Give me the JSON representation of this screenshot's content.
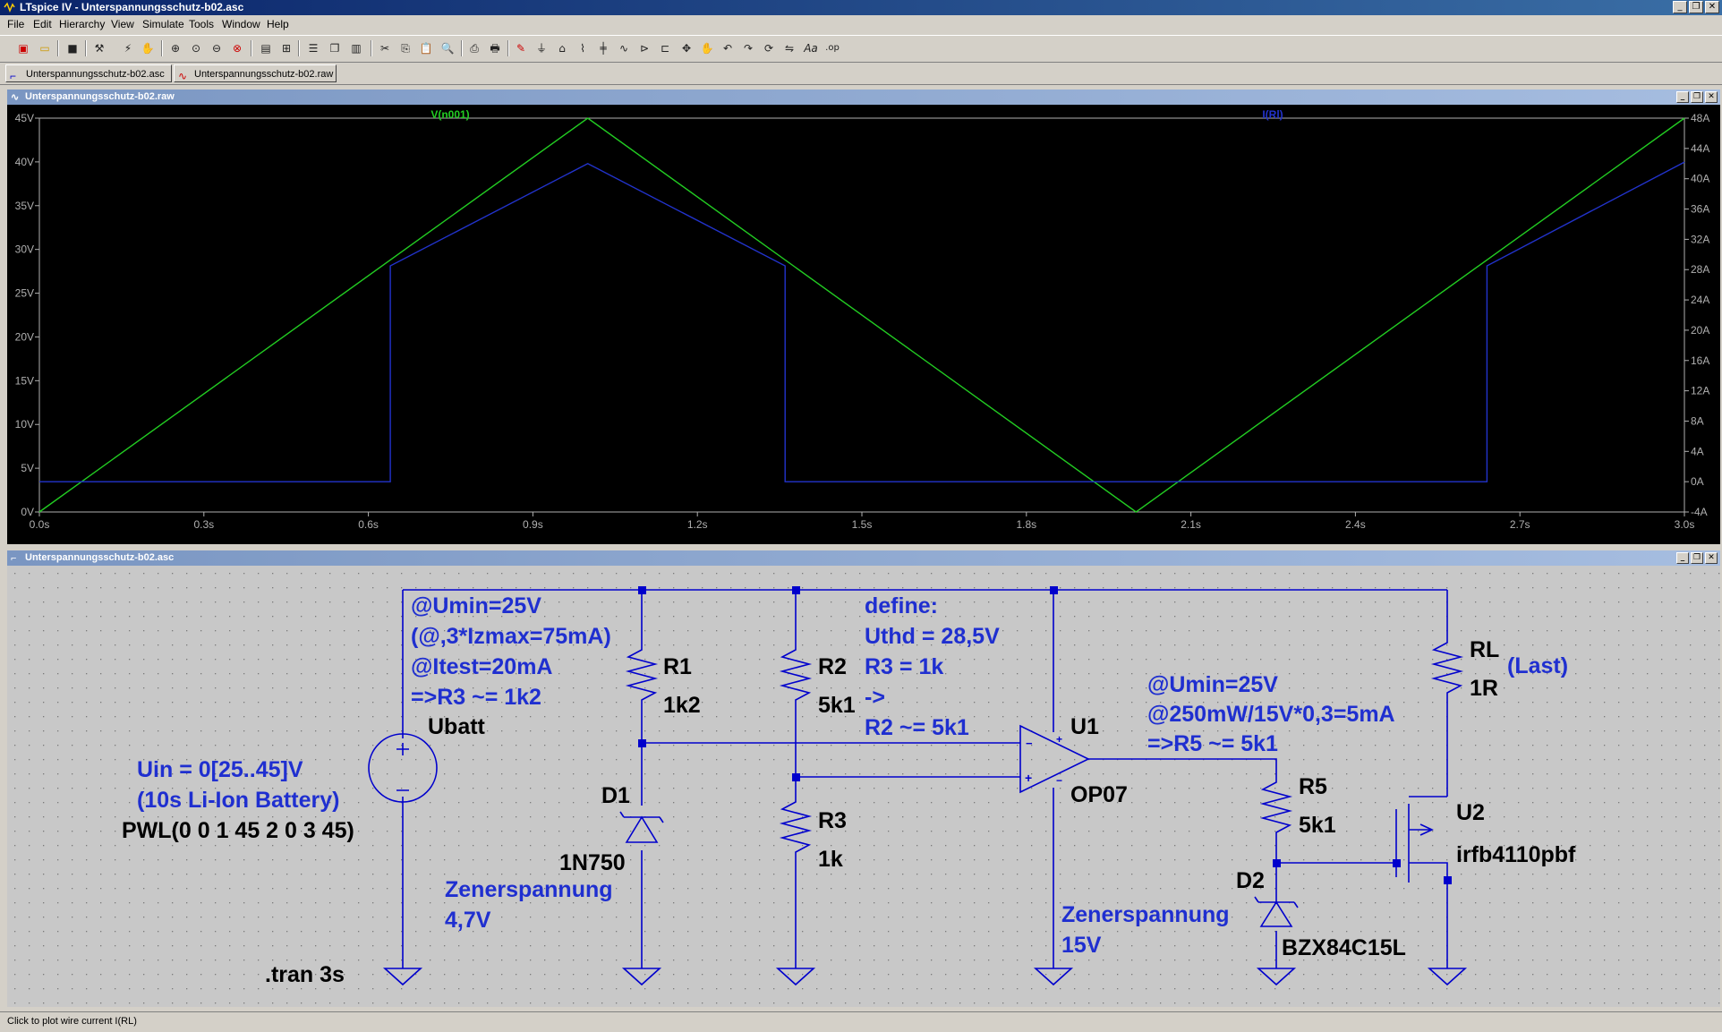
{
  "app": {
    "title": "LTspice IV - Unterspannungsschutz-b02.asc",
    "window_buttons": [
      "_",
      "❐",
      "✕"
    ]
  },
  "menu": [
    "File",
    "Edit",
    "Hierarchy",
    "View",
    "Simulate",
    "Tools",
    "Window",
    "Help"
  ],
  "tabs": [
    {
      "label": "Unterspannungsschutz-b02.asc",
      "icon": "schematic-icon"
    },
    {
      "label": "Unterspannungsschutz-b02.raw",
      "icon": "waveform-icon"
    }
  ],
  "plot_window": {
    "title": "Unterspannungsschutz-b02.raw",
    "trace_labels": [
      "V(n001)",
      "I(Rl)"
    ]
  },
  "schematic_window": {
    "title": "Unterspannungsschutz-b02.asc"
  },
  "schematic": {
    "texts": {
      "note1_1": "@Umin=25V",
      "note1_2": "(@,3*Izmax=75mA)",
      "note1_3": "@Itest=20mA",
      "note1_4": "=>R3 ~= 1k2",
      "ubatt": "Ubatt",
      "uin_1": "Uin = 0[25..45]V",
      "uin_2": "(10s Li-Ion Battery)",
      "pwl": "PWL(0 0 1 45 2 0 3 45)",
      "tran": ".tran 3s",
      "r1": "R1",
      "r1_val": "1k2",
      "d1": "D1",
      "d1_part": "1N750",
      "zener1_1": "Zenerspannung",
      "zener1_2": "4,7V",
      "r2": "R2",
      "r2_val": "5k1",
      "r3": "R3",
      "r3_val": "1k",
      "define_1": "define:",
      "define_2": "Uthd = 28,5V",
      "define_3": "R3 = 1k",
      "define_4": "->",
      "define_5": "R2 ~= 5k1",
      "u1": "U1",
      "u1_part": "OP07",
      "zener2_1": "Zenerspannung",
      "zener2_2": "15V",
      "note2_1": "@Umin=25V",
      "note2_2": "@250mW/15V*0,3=5mA",
      "note2_3": "=>R5 ~= 5k1",
      "r5": "R5",
      "r5_val": "5k1",
      "d2": "D2",
      "d2_part": "BZX84C15L",
      "rl": "RL",
      "rl_val": "1R",
      "last": "(Last)",
      "u2": "U2",
      "u2_part": "irfb4110pbf",
      "plus": "+",
      "minus": "−"
    }
  },
  "status": {
    "text": "Click to plot wire current I(RL)"
  },
  "colors": {
    "plot_bg": "#000000",
    "trace_v": "#22cc22",
    "trace_i": "#2233cc",
    "schematic_bg": "#c8c8c8",
    "wire": "#0000cc",
    "component_text": "#000000",
    "note_text": "#1f2fd0"
  },
  "chart_data": {
    "type": "line",
    "x_tick_labels": [
      "0.0s",
      "0.3s",
      "0.6s",
      "0.9s",
      "1.2s",
      "1.5s",
      "1.8s",
      "2.1s",
      "2.4s",
      "2.7s",
      "3.0s"
    ],
    "y_left_tick_labels": [
      "0V",
      "5V",
      "10V",
      "15V",
      "20V",
      "25V",
      "30V",
      "35V",
      "40V",
      "45V"
    ],
    "y_right_tick_labels": [
      "-4A",
      "0A",
      "4A",
      "8A",
      "12A",
      "16A",
      "20A",
      "24A",
      "28A",
      "32A",
      "36A",
      "40A",
      "44A",
      "48A"
    ],
    "xlim": [
      0,
      3
    ],
    "ylim_left": [
      0,
      45
    ],
    "ylim_right": [
      -4,
      48
    ],
    "grid": false,
    "series": [
      {
        "name": "V(n001)",
        "axis": "left",
        "x": [
          0,
          1,
          2,
          3
        ],
        "y": [
          0,
          45,
          0,
          45
        ]
      },
      {
        "name": "I(Rl)",
        "axis": "right",
        "x": [
          0,
          0.64,
          0.64,
          1,
          1.36,
          1.36,
          2.64,
          2.64,
          3
        ],
        "y": [
          0,
          0,
          28.5,
          42,
          28.5,
          0,
          0,
          28.5,
          42.2
        ]
      }
    ]
  }
}
